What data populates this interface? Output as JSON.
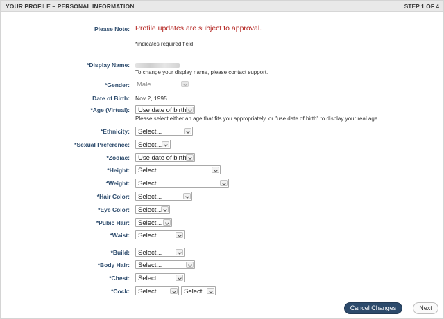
{
  "header": {
    "title": "YOUR PROFILE – PERSONAL INFORMATION",
    "step": "STEP 1 OF 4"
  },
  "note": {
    "label": "Please Note:",
    "text": "Profile updates are subject to approval.",
    "required_hint": "*indicates required field"
  },
  "display_name": {
    "label": "*Display Name:",
    "help": "To change your display name, please contact support."
  },
  "gender": {
    "label": "*Gender:",
    "value": "Male"
  },
  "dob": {
    "label": "Date of Birth:",
    "value": "Nov 2, 1995"
  },
  "age_virtual": {
    "label": "*Age (Virtual):",
    "value": "Use date of birth",
    "help": "Please select either an age that fits you appropriately, or \"use date of birth\" to display your real age."
  },
  "ethnicity": {
    "label": "*Ethnicity:",
    "value": "Select..."
  },
  "sexual_preference": {
    "label": "*Sexual Preference:",
    "value": "Select..."
  },
  "zodiac": {
    "label": "*Zodiac:",
    "value": "Use date of birth"
  },
  "height": {
    "label": "*Height:",
    "value": "Select..."
  },
  "weight": {
    "label": "*Weight:",
    "value": "Select..."
  },
  "hair_color": {
    "label": "*Hair Color:",
    "value": "Select..."
  },
  "eye_color": {
    "label": "*Eye Color:",
    "value": "Select..."
  },
  "pubic_hair": {
    "label": "*Pubic Hair:",
    "value": "Select..."
  },
  "waist": {
    "label": "*Waist:",
    "value": "Select..."
  },
  "build": {
    "label": "*Build:",
    "value": "Select..."
  },
  "body_hair": {
    "label": "*Body Hair:",
    "value": "Select..."
  },
  "chest": {
    "label": "*Chest:",
    "value": "Select..."
  },
  "cock": {
    "label": "*Cock:",
    "value_1": "Select...",
    "value_2": "Select..."
  },
  "actions": {
    "cancel": "Cancel Changes",
    "next": "Next"
  }
}
